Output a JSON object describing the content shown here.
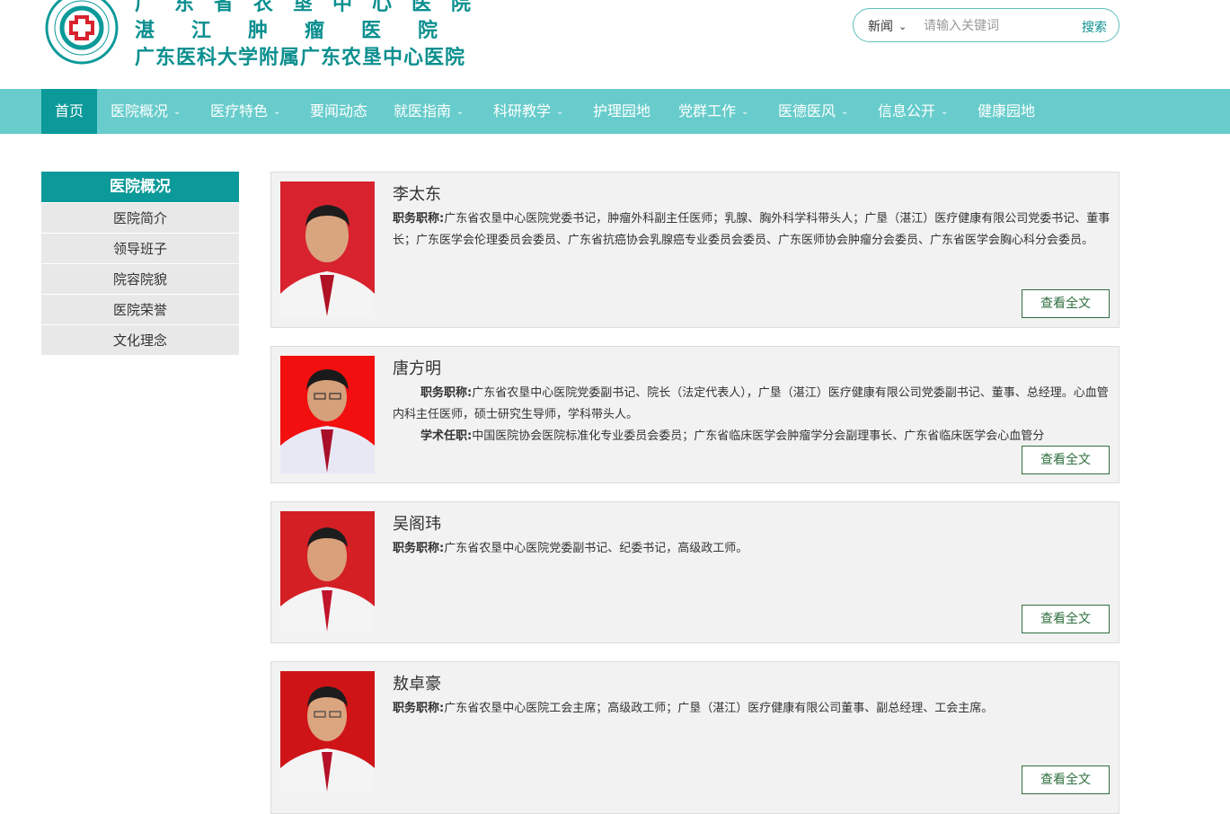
{
  "header": {
    "logo_lines": [
      "广东省农垦中心医院",
      "湛江肿瘤医院",
      "广东医科大学附属广东农垦中心医院"
    ],
    "search": {
      "category": "新闻",
      "placeholder": "请输入关键词",
      "button": "搜索"
    }
  },
  "nav": {
    "items": [
      {
        "label": "首页"
      },
      {
        "label": "医院概况"
      },
      {
        "label": "医疗特色"
      },
      {
        "label": "要闻动态"
      },
      {
        "label": "就医指南"
      },
      {
        "label": "科研教学"
      },
      {
        "label": "护理园地"
      },
      {
        "label": "党群工作"
      },
      {
        "label": "医德医风"
      },
      {
        "label": "信息公开"
      },
      {
        "label": "健康园地"
      }
    ]
  },
  "sidebar": {
    "title": "医院概况",
    "items": [
      "医院简介",
      "领导班子",
      "院容院貌",
      "医院荣誉",
      "文化理念"
    ]
  },
  "leaders": [
    {
      "name": "李太东",
      "label1": "职务职称:",
      "text1": "广东省农垦中心医院党委书记，肿瘤外科副主任医师；乳腺、胸外科学科带头人；广垦（湛江）医疗健康有限公司党委书记、董事长；广东医学会伦理委员会委员、广东省抗癌协会乳腺癌专业委员会委员、广东医师协会肿瘤分会委员、广东省医学会胸心科分会委员。",
      "button": "查看全文"
    },
    {
      "name": "唐方明",
      "label1": "职务职称:",
      "text1": "广东省农垦中心医院党委副书记、院长（法定代表人），广垦（湛江）医疗健康有限公司党委副书记、董事、总经理。心血管内科主任医师，硕士研究生导师，学科带头人。",
      "label2": "学术任职:",
      "text2": "中国医院协会医院标准化专业委员会委员；广东省临床医学会肿瘤学分会副理事长、广东省临床医学会心血管分",
      "button": "查看全文"
    },
    {
      "name": "吴阁玮",
      "label1": "职务职称:",
      "text1": "广东省农垦中心医院党委副书记、纪委书记，高级政工师。",
      "button": "查看全文"
    },
    {
      "name": "敖卓豪",
      "label1": "职务职称:",
      "text1": "广东省农垦中心医院工会主席；高级政工师；广垦（湛江）医疗健康有限公司董事、副总经理、工会主席。",
      "button": "查看全文"
    }
  ],
  "colors": {
    "brand": "#0c9999",
    "nav_bg": "#67cccb",
    "card_bg": "#f2f2f2",
    "button_border": "#2f6f3f"
  }
}
